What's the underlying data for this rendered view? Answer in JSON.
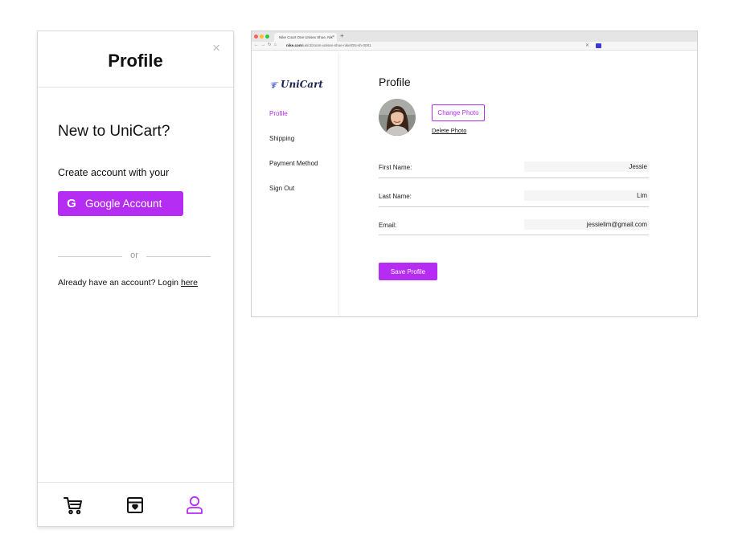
{
  "mobile": {
    "title": "Profile",
    "close_symbol": "×",
    "heading": "New to UniCart?",
    "create_text": "Create account with your",
    "google_button": {
      "icon": "google-g-icon",
      "letter": "G",
      "label": "Google Account"
    },
    "divider_text": "or",
    "login_text": "Already have an account? Login ",
    "login_link": "here",
    "tabbar": {
      "items": [
        {
          "icon": "cart-icon",
          "active": false
        },
        {
          "icon": "package-box-icon",
          "active": false
        },
        {
          "icon": "user-icon",
          "active": true
        }
      ]
    }
  },
  "browser": {
    "tab_title": "Nike Court One Unisex Shoe, Nik",
    "url_host": "nike.com",
    "url_path": "/us/ct/zoom-unisex-shoe-nike/DN-sh-0001"
  },
  "desktop": {
    "logo": "UniCart",
    "sidebar": {
      "items": [
        {
          "label": "Profile",
          "active": true
        },
        {
          "label": "Shipping",
          "active": false
        },
        {
          "label": "Payment Method",
          "active": false
        },
        {
          "label": "Sign Out",
          "active": false
        }
      ]
    },
    "title": "Profile",
    "change_photo": "Change Photo",
    "delete_photo": "Delete Photo",
    "fields": [
      {
        "label": "First Name:",
        "value": "Jessie"
      },
      {
        "label": "Last Name:",
        "value": "Lim"
      },
      {
        "label": "Email:",
        "value": "jessielim@gmail.com"
      }
    ],
    "save_button": "Save Profile"
  },
  "colors": {
    "accent": "#b52df2",
    "logo": "#1b2450",
    "divider": "#e3e3e3"
  }
}
